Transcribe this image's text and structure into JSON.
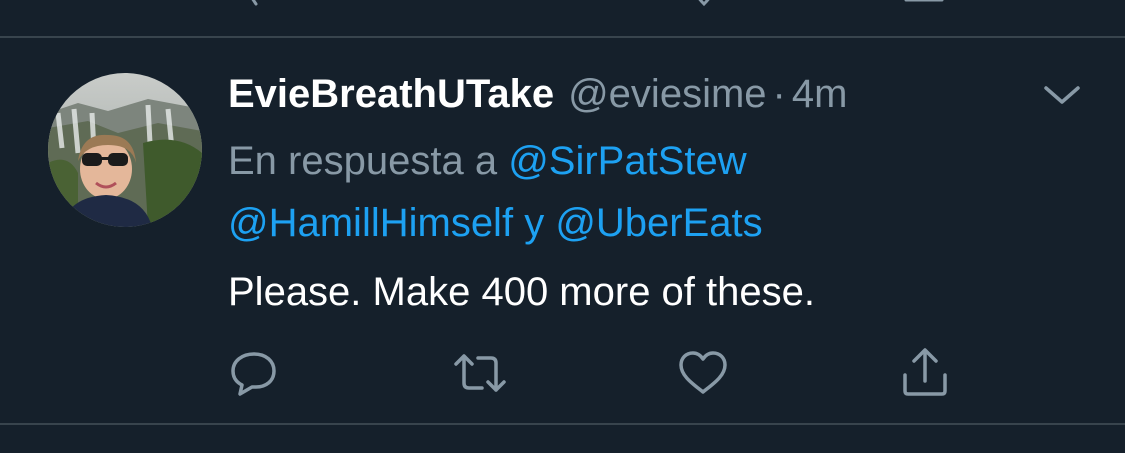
{
  "tweet": {
    "display_name": "EvieBreathUTake",
    "handle": "@eviesime",
    "separator": "·",
    "time": "4m",
    "reply_prefix": "En respuesta a",
    "reply_to": [
      "@SirPatStew",
      "@HamillHimself",
      "@UberEats"
    ],
    "reply_joiner": "y",
    "text": "Please. Make 400 more of these."
  },
  "icons": {
    "menu": "chevron-down-icon",
    "reply": "reply-bubble-icon",
    "retweet": "retweet-icon",
    "like": "heart-icon",
    "share": "share-upload-icon"
  },
  "colors": {
    "background": "#15202b",
    "divider": "#38444d",
    "primary_text": "#ffffff",
    "secondary_text": "#8899a6",
    "link": "#1da1f2"
  }
}
